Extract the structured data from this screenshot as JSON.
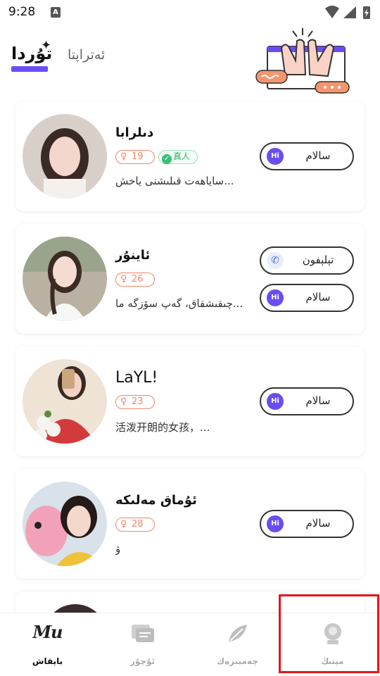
{
  "status_bar": {
    "time": "9:28",
    "notif_letter": "A"
  },
  "header": {
    "tab_active": "تۇردا",
    "tab_inactive": "ئەتراپتا"
  },
  "users": [
    {
      "name": "دىلرابا",
      "age": "19",
      "verified": "真人",
      "bio": "ساياھەت قىلىشنى    ياخش...",
      "buttons": [
        {
          "icon": "hi-icon",
          "label": "سالام"
        }
      ]
    },
    {
      "name": "ئاينۇر",
      "age": "26",
      "bio": "چىقىشقاق، گەپ سۆزگە ما...",
      "buttons": [
        {
          "icon": "phone-icon",
          "label": "تېلېفون"
        },
        {
          "icon": "hi-icon",
          "label": "سالام"
        }
      ]
    },
    {
      "name": "LaYL!",
      "age": "23",
      "bio": "活泼开朗的女孩，...",
      "buttons": [
        {
          "icon": "hi-icon",
          "label": "سالام"
        }
      ]
    },
    {
      "name": "ئۇماق مەلىكە",
      "age": "28",
      "bio": "ۋ",
      "buttons": [
        {
          "icon": "hi-icon",
          "label": "سالام"
        }
      ]
    }
  ],
  "age_symbol": "♀",
  "hi_text": "Hi",
  "bottom_nav": [
    {
      "label": "بايقاش",
      "icon": "mu-logo-icon",
      "logo_text": "Mu",
      "active": true
    },
    {
      "label": "ئۇچۇر",
      "icon": "chat-icon",
      "active": false
    },
    {
      "label": "چەمبىرەك",
      "icon": "feather-icon",
      "active": false
    },
    {
      "label": "مېنىڭ",
      "icon": "profile-icon",
      "active": false
    }
  ],
  "colors": {
    "accent": "#6c4cf2",
    "age_badge": "#f0876a",
    "verify": "#35c274",
    "highlight": "#e8141b"
  }
}
